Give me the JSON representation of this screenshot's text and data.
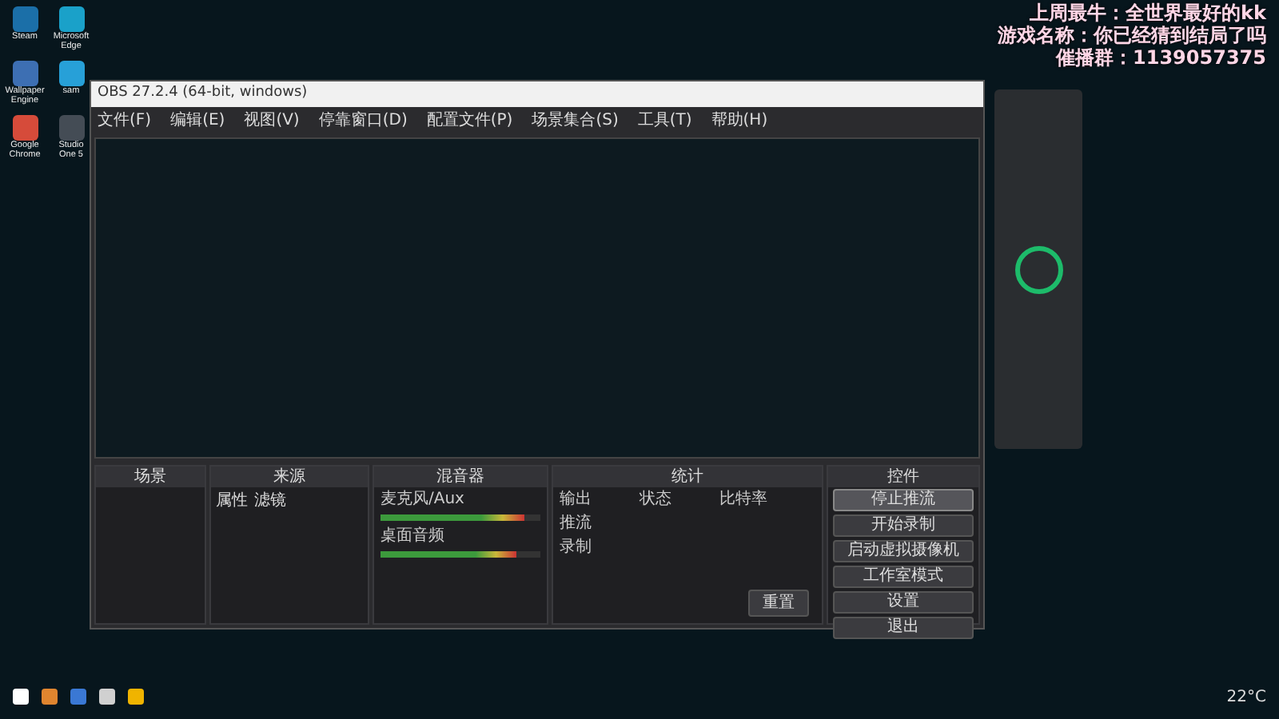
{
  "overlay": {
    "lines": [
      "上周最牛：全世界最好的kk",
      "游戏名称：你已经猜到结局了吗",
      "催播群：1139057375"
    ]
  },
  "desktop_icons": [
    {
      "label": "Steam",
      "color": "#1b6fa8"
    },
    {
      "label": "Microsoft Edge",
      "color": "#1aa1c9"
    },
    {
      "label": "Wallpaper Engine",
      "color": "#3d6fb3"
    },
    {
      "label": "sam",
      "color": "#27a0d8"
    },
    {
      "label": "Google Chrome",
      "color": "#d64b3a"
    },
    {
      "label": "Studio One 5",
      "color": "#444c55"
    }
  ],
  "obs": {
    "title": "OBS 27.2.4 (64-bit, windows)",
    "menu": [
      "文件(F)",
      "编辑(E)",
      "视图(V)",
      "停靠窗口(D)",
      "配置文件(P)",
      "场景集合(S)",
      "工具(T)",
      "帮助(H)"
    ],
    "scenes": {
      "title": "场景"
    },
    "sources": {
      "title": "来源",
      "toolbar": [
        "属性",
        "滤镜"
      ]
    },
    "mixer": {
      "title": "混音器",
      "channels": [
        {
          "name": "麦克风/Aux",
          "level": 0.9,
          "muted": false
        },
        {
          "name": "桌面音频",
          "level": 0.85,
          "muted": false
        }
      ]
    },
    "stats": {
      "title": "统计",
      "columns": [
        "输出",
        "状态",
        "比特率"
      ],
      "rows_labels": [
        "推流",
        "录制"
      ],
      "reset": "重置"
    },
    "controls": {
      "title": "控件",
      "buttons": [
        {
          "label": "停止推流",
          "active": true
        },
        {
          "label": "开始录制",
          "active": false
        },
        {
          "label": "启动虚拟摄像机",
          "active": false
        },
        {
          "label": "工作室模式",
          "active": false
        },
        {
          "label": "设置",
          "active": false
        },
        {
          "label": "退出",
          "active": false
        }
      ]
    }
  },
  "taskbar": {
    "weather": "22°C"
  }
}
